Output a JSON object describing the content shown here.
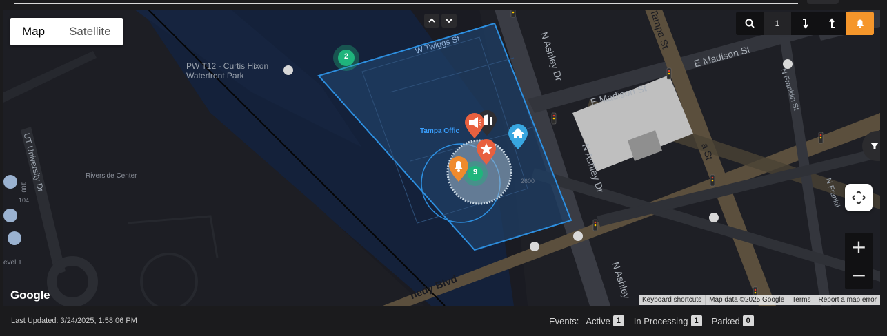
{
  "map": {
    "type_control": {
      "map_label": "Map",
      "satellite_label": "Satellite",
      "selected": "Map"
    },
    "toolbar": {
      "count": "1"
    },
    "labels": {
      "park": "PW T12 - Curtis Hixon\nWaterfront Park",
      "riverside": "Riverside Center",
      "twiggs": "W Twiggs St",
      "madison_upper": "E Madison St",
      "madison_lower": "E Madison St",
      "ashley_upper": "N Ashley Dr",
      "ashley_mid": "N Ashley Dr",
      "ashley_lower": "N Ashley",
      "tampa_st_upper": "Tampa St",
      "tampa_st_mid": "a St",
      "franklin_upper": "N Franklin St",
      "franklin_lower": "N Frankli",
      "ut_university": "UT University Dr",
      "kennedy": "nedy Blvd",
      "tampa_office": "Tampa Offic",
      "number_2600": "2600",
      "level_1": "evel 1",
      "num_100": "100",
      "num_104": "104"
    },
    "clusters": {
      "green_cluster": "2",
      "event_cluster": "9"
    },
    "google_logo": "Google",
    "attribution": [
      "Keyboard shortcuts",
      "Map data ©2025 Google",
      "Terms",
      "Report a map error"
    ]
  },
  "footer": {
    "last_updated": "Last Updated: 3/24/2025, 1:58:06 PM",
    "events_label": "Events:",
    "active_label": "Active",
    "active_count": "1",
    "processing_label": "In Processing",
    "processing_count": "1",
    "parked_label": "Parked",
    "parked_count": "0"
  },
  "colors": {
    "accent": "#f5962b",
    "geofence_stroke": "#2d8fe0",
    "cluster_green": "#1fb57c",
    "marker_red": "#e8603f",
    "marker_orange": "#f08a2c",
    "marker_blue": "#38a6e0"
  }
}
